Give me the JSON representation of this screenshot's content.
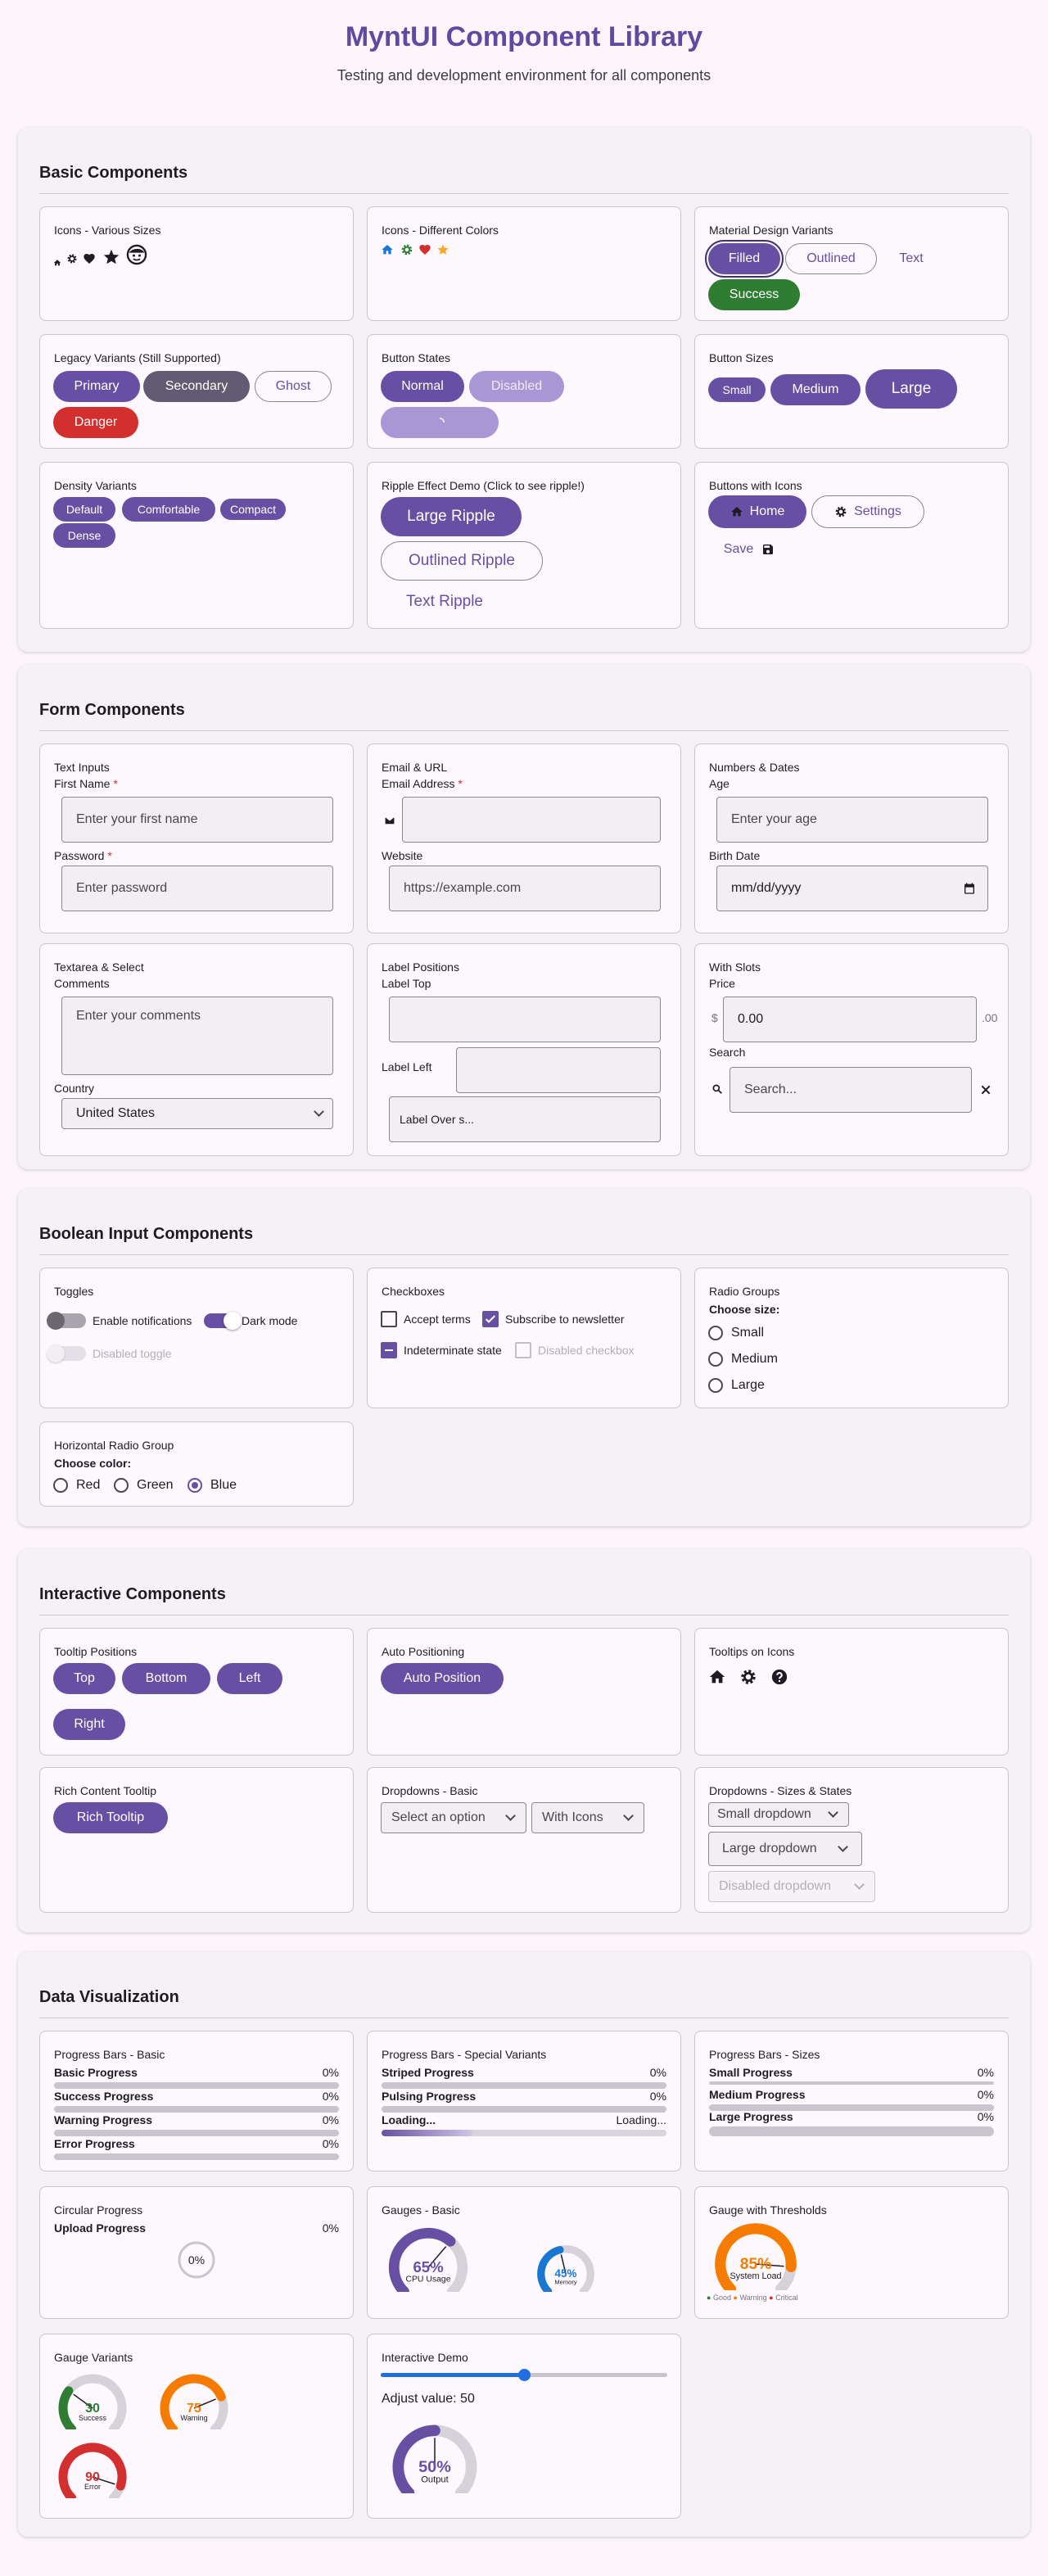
{
  "header": {
    "title": "MyntUI Component Library",
    "subtitle": "Testing and development environment for all components"
  },
  "colors": {
    "primary": "#6750a4",
    "secondary": "#625b71",
    "success": "#2e7d32",
    "danger": "#d32f2f",
    "gauge_orange": "#f57c00",
    "gauge_blue": "#1976d2",
    "slider_blue": "#1f6fe0"
  },
  "basic": {
    "title": "Basic Components",
    "icons_sizes": {
      "title": "Icons - Various Sizes",
      "icons": [
        "home-icon",
        "settings-icon",
        "heart-icon",
        "star-icon",
        "face-icon"
      ]
    },
    "icons_colors": {
      "title": "Icons - Different Colors",
      "icons": [
        "home-icon",
        "settings-icon",
        "heart-icon",
        "star-icon"
      ]
    },
    "material": {
      "title": "Material Design Variants",
      "filled": "Filled",
      "outlined": "Outlined",
      "text": "Text",
      "success": "Success"
    },
    "legacy": {
      "title": "Legacy Variants (Still Supported)",
      "primary": "Primary",
      "secondary": "Secondary",
      "ghost": "Ghost",
      "danger": "Danger"
    },
    "states": {
      "title": "Button States",
      "normal": "Normal",
      "disabled": "Disabled"
    },
    "sizes": {
      "title": "Button Sizes",
      "small": "Small",
      "medium": "Medium",
      "large": "Large"
    },
    "density": {
      "title": "Density Variants",
      "default": "Default",
      "comfortable": "Comfortable",
      "compact": "Compact",
      "dense": "Dense"
    },
    "ripple": {
      "title": "Ripple Effect Demo (Click to see ripple!)",
      "large": "Large Ripple",
      "outlined": "Outlined Ripple",
      "text": "Text Ripple"
    },
    "with_icons": {
      "title": "Buttons with Icons",
      "home": "Home",
      "settings": "Settings",
      "save": "Save"
    }
  },
  "forms": {
    "title": "Form Components",
    "text_inputs": {
      "title": "Text Inputs",
      "first_name_label": "First Name",
      "first_name_placeholder": "Enter your first name",
      "password_label": "Password",
      "password_placeholder": "Enter password",
      "required_mark": "*"
    },
    "email_url": {
      "title": "Email & URL",
      "email_label": "Email Address",
      "website_label": "Website",
      "website_value": "https://example.com"
    },
    "numbers_dates": {
      "title": "Numbers & Dates",
      "age_label": "Age",
      "age_placeholder": "Enter your age",
      "birth_label": "Birth Date",
      "birth_placeholder": "mm/dd/yyyy"
    },
    "textarea_select": {
      "title": "Textarea & Select",
      "comments_label": "Comments",
      "comments_placeholder": "Enter your comments",
      "country_label": "Country",
      "country_value": "United States"
    },
    "label_positions": {
      "title": "Label Positions",
      "top": "Label Top",
      "left": "Label Left",
      "over": "Label Over s..."
    },
    "with_slots": {
      "title": "With Slots",
      "price_label": "Price",
      "price_prefix": "$",
      "price_value": "0.00",
      "price_suffix": ".00",
      "search_label": "Search",
      "search_placeholder": "Search..."
    }
  },
  "booleans": {
    "title": "Boolean Input Components",
    "toggles": {
      "title": "Toggles",
      "notifications": "Enable notifications",
      "dark_mode": "Dark mode",
      "disabled": "Disabled toggle"
    },
    "checkboxes": {
      "title": "Checkboxes",
      "accept": "Accept terms",
      "subscribe": "Subscribe to newsletter",
      "indeterminate": "Indeterminate state",
      "disabled": "Disabled checkbox"
    },
    "radio_groups": {
      "title": "Radio Groups",
      "prompt": "Choose size:",
      "options": [
        "Small",
        "Medium",
        "Large"
      ]
    },
    "horizontal_radio": {
      "title": "Horizontal Radio Group",
      "prompt": "Choose color:",
      "options": [
        "Red",
        "Green",
        "Blue"
      ],
      "selected": "Blue"
    }
  },
  "interactive": {
    "title": "Interactive Components",
    "tooltip_positions": {
      "title": "Tooltip Positions",
      "top": "Top",
      "bottom": "Bottom",
      "left": "Left",
      "right": "Right"
    },
    "auto_positioning": {
      "title": "Auto Positioning",
      "button": "Auto Position"
    },
    "tooltips_icons": {
      "title": "Tooltips on Icons",
      "icons": [
        "home-icon",
        "settings-icon",
        "help-icon"
      ]
    },
    "rich_tooltip": {
      "title": "Rich Content Tooltip",
      "button": "Rich Tooltip"
    },
    "dropdowns_basic": {
      "title": "Dropdowns - Basic",
      "select": "Select an option",
      "with_icons": "With Icons"
    },
    "dropdowns_sizes": {
      "title": "Dropdowns - Sizes & States",
      "small": "Small dropdown",
      "large": "Large dropdown",
      "disabled": "Disabled dropdown"
    }
  },
  "dataviz": {
    "title": "Data Visualization",
    "progress_basic": {
      "title": "Progress Bars - Basic",
      "bars": [
        {
          "label": "Basic Progress",
          "value": "0%"
        },
        {
          "label": "Success Progress",
          "value": "0%"
        },
        {
          "label": "Warning Progress",
          "value": "0%"
        },
        {
          "label": "Error Progress",
          "value": "0%"
        }
      ]
    },
    "progress_special": {
      "title": "Progress Bars - Special Variants",
      "striped": "Striped Progress",
      "striped_value": "0%",
      "pulsing": "Pulsing Progress",
      "pulsing_value": "0%",
      "loading": "Loading...",
      "loading_right": "Loading..."
    },
    "progress_sizes": {
      "title": "Progress Bars - Sizes",
      "bars": [
        {
          "label": "Small Progress",
          "value": "0%"
        },
        {
          "label": "Medium Progress",
          "value": "0%"
        },
        {
          "label": "Large Progress",
          "value": "0%"
        }
      ]
    },
    "circular": {
      "title": "Circular Progress",
      "label": "Upload Progress",
      "value": "0%",
      "center": "0%"
    },
    "gauges_basic": {
      "title": "Gauges - Basic",
      "g1": {
        "value": 65,
        "text": "65%",
        "label": "CPU Usage",
        "min": "0",
        "max": "100"
      },
      "g2": {
        "value": 45,
        "text": "45%",
        "label": "Memory",
        "min": "0",
        "max": "100"
      }
    },
    "gauge_thresholds": {
      "title": "Gauge with Thresholds",
      "value": 85,
      "text": "85%",
      "label": "System Load",
      "min": "0",
      "max": "100",
      "legend": [
        "Good",
        "Warning",
        "Critical"
      ]
    },
    "gauge_variants": {
      "title": "Gauge Variants",
      "g1": {
        "value": 30,
        "text": "30",
        "label": "Success",
        "min": "0",
        "max": "100"
      },
      "g2": {
        "value": 75,
        "text": "75",
        "label": "Warning",
        "min": "0",
        "max": "100"
      },
      "g3": {
        "value": 90,
        "text": "90",
        "label": "Error",
        "min": "0",
        "max": "100"
      }
    },
    "interactive_demo": {
      "title": "Interactive Demo",
      "slider_value": 50,
      "adjust_label": "Adjust value: 50",
      "gauge_text": "50%",
      "gauge_label": "Output",
      "min": "0",
      "max": "100"
    }
  }
}
